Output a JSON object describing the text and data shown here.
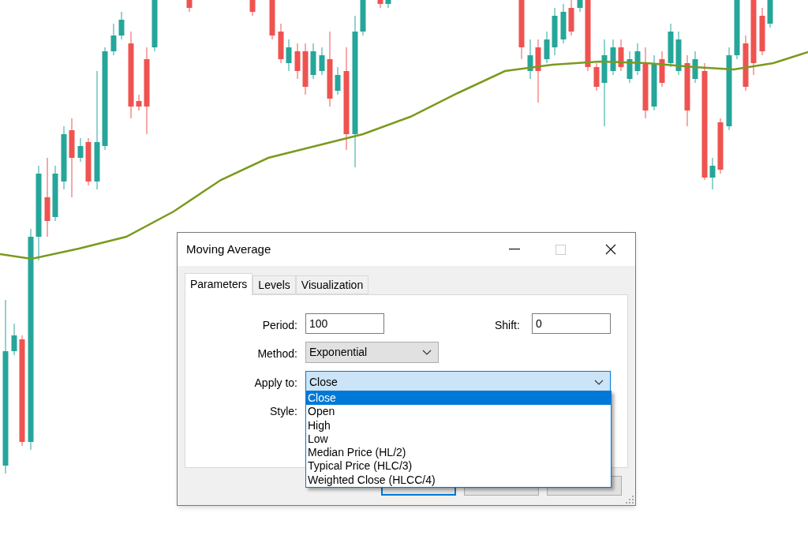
{
  "dialog": {
    "title": "Moving Average"
  },
  "tabs": [
    {
      "label": "Parameters",
      "selected": true
    },
    {
      "label": "Levels",
      "selected": false
    },
    {
      "label": "Visualization",
      "selected": false
    }
  ],
  "period": {
    "label": "Period:",
    "value": "100"
  },
  "shift": {
    "label": "Shift:",
    "value": "0"
  },
  "method": {
    "label": "Method:",
    "value": "Exponential"
  },
  "apply_to": {
    "label": "Apply to:",
    "value": "Close",
    "expanded": true,
    "options": [
      {
        "label": "Close",
        "selected": true
      },
      {
        "label": "Open",
        "selected": false
      },
      {
        "label": "High",
        "selected": false
      },
      {
        "label": "Low",
        "selected": false
      },
      {
        "label": "Median Price (HL/2)",
        "selected": false
      },
      {
        "label": "Typical Price (HLC/3)",
        "selected": false
      },
      {
        "label": "Weighted Close (HLCC/4)",
        "selected": false
      }
    ]
  },
  "style": {
    "label": "Style:"
  },
  "buttons": [
    {
      "default": true
    },
    {
      "default": false
    },
    {
      "default": false
    }
  ]
}
